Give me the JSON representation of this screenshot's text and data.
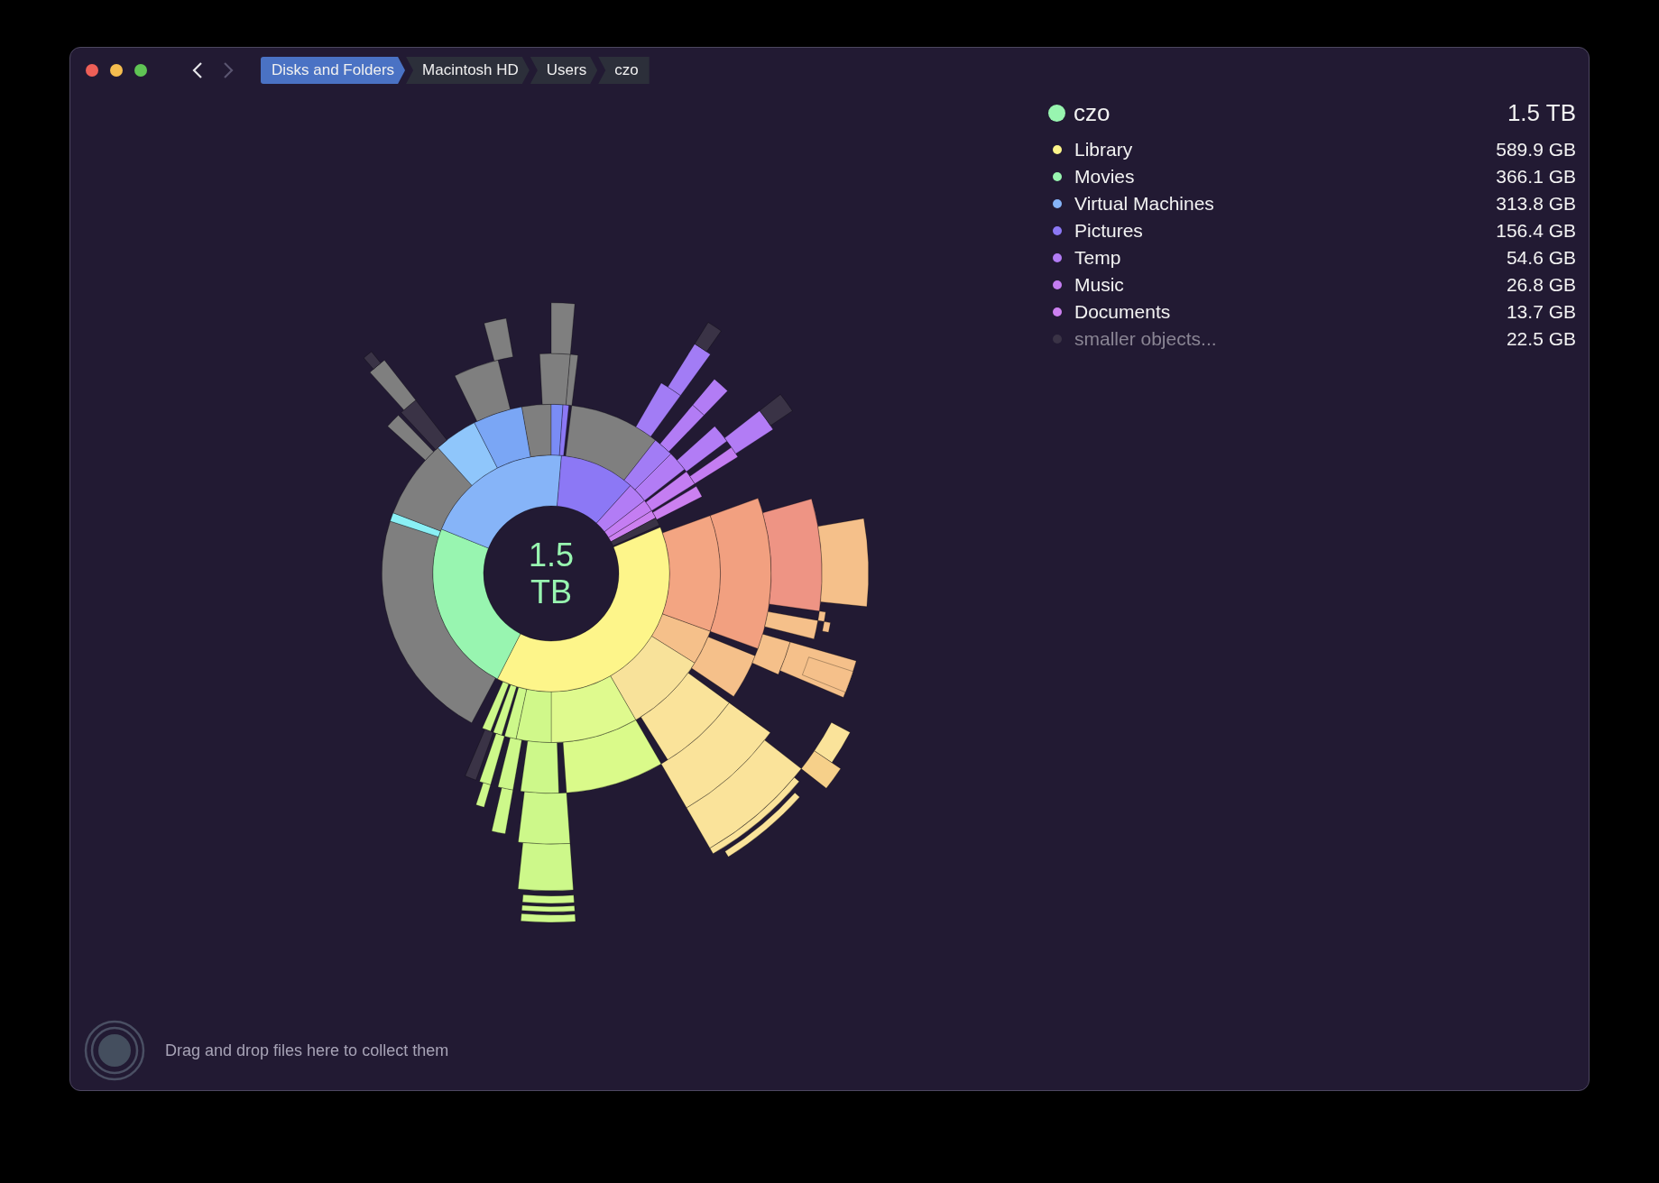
{
  "window": {
    "traffic_lights": [
      {
        "color": "#ee5f57"
      },
      {
        "color": "#f5bd4f"
      },
      {
        "color": "#5fc454"
      }
    ]
  },
  "navigation": {
    "back": {
      "disabled": false
    },
    "forward": {
      "disabled": true
    }
  },
  "breadcrumbs": [
    {
      "label": "Disks and Folders",
      "selected": true
    },
    {
      "label": "Macintosh HD",
      "selected": false
    },
    {
      "label": "Users",
      "selected": false
    },
    {
      "label": "czo",
      "selected": false
    }
  ],
  "chart": {
    "center_label": "1.5 TB"
  },
  "legend": {
    "header": {
      "name": "czo",
      "size": "1.5 TB",
      "color": "#98f5b0"
    },
    "items": [
      {
        "name": "Library",
        "size": "589.9 GB",
        "color": "#fdf58a",
        "dimmed": false
      },
      {
        "name": "Movies",
        "size": "366.1 GB",
        "color": "#98f5b0",
        "dimmed": false
      },
      {
        "name": "Virtual Machines",
        "size": "313.8 GB",
        "color": "#86b4f8",
        "dimmed": false
      },
      {
        "name": "Pictures",
        "size": "156.4 GB",
        "color": "#8c78f5",
        "dimmed": false
      },
      {
        "name": "Temp",
        "size": "54.6 GB",
        "color": "#b27cf5",
        "dimmed": false
      },
      {
        "name": "Music",
        "size": "26.8 GB",
        "color": "#c47df2",
        "dimmed": false
      },
      {
        "name": "Documents",
        "size": "13.7 GB",
        "color": "#cc80f0",
        "dimmed": false
      },
      {
        "name": "smaller objects...",
        "size": "22.5 GB",
        "color": "#3a3346",
        "dimmed": true
      }
    ]
  },
  "drop_zone": {
    "text": "Drag and drop files here to collect them"
  }
}
